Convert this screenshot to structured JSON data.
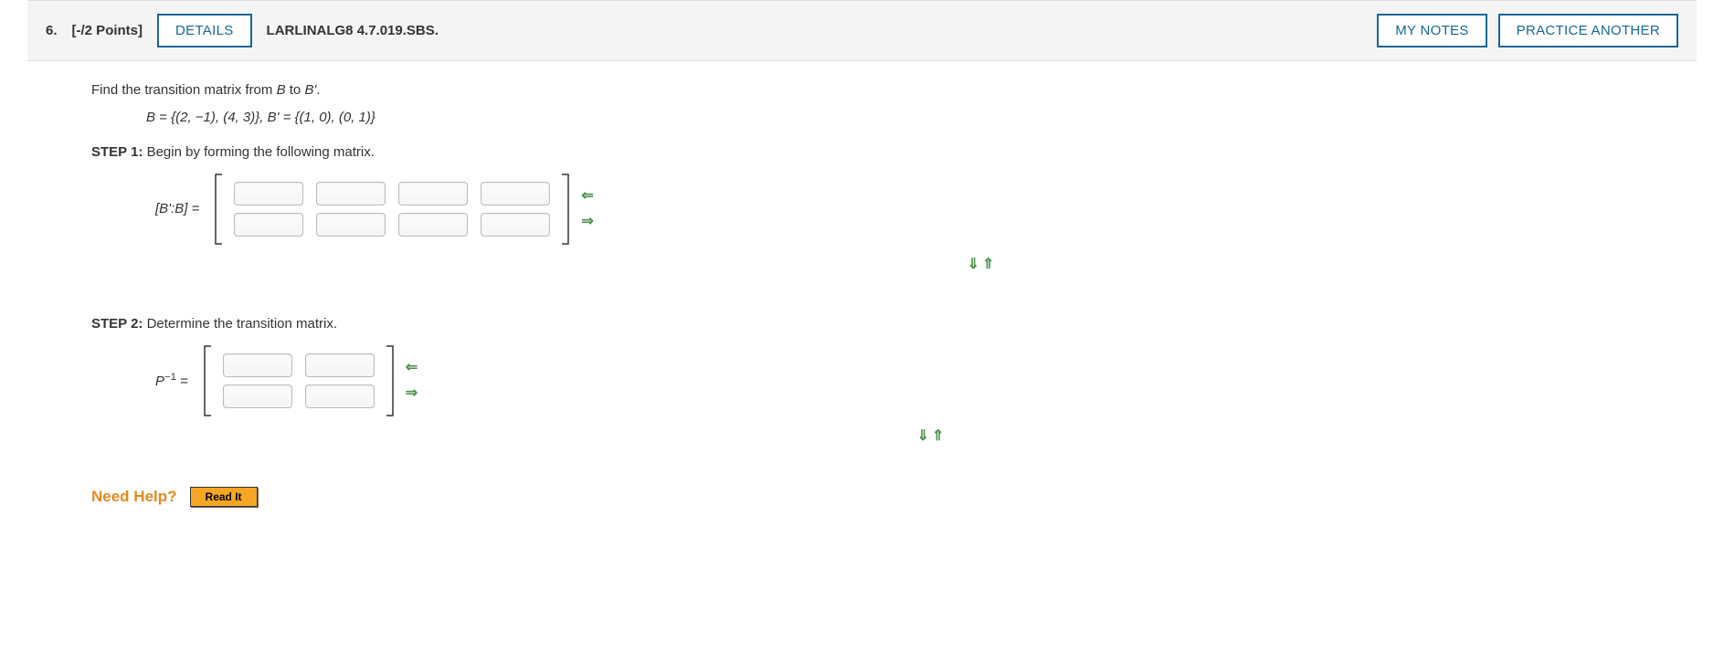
{
  "header": {
    "number": "6.",
    "points": "[-/2 Points]",
    "details": "DETAILS",
    "reference": "LARLINALG8 4.7.019.SBS.",
    "my_notes": "MY NOTES",
    "practice_another": "PRACTICE ANOTHER"
  },
  "body": {
    "prompt_pre": "Find the transition matrix from ",
    "prompt_b": "B",
    "prompt_mid": " to ",
    "prompt_bprime": "B'",
    "prompt_post": ".",
    "equation": "B = {(2, −1), (4, 3)}, B' = {(1, 0), (0, 1)}",
    "step1_label": "STEP 1:",
    "step1_text": " Begin by forming the following matrix.",
    "matrix1_label_pre": "[",
    "matrix1_label_bprime": "B'",
    "matrix1_label_colon": ":",
    "matrix1_label_b": "B",
    "matrix1_label_post": "] =",
    "step2_label": "STEP 2:",
    "step2_text": " Determine the transition matrix.",
    "matrix2_label": "P",
    "matrix2_exp": "−1",
    "matrix2_eq": " =",
    "need_help": "Need Help?",
    "read_it": "Read It"
  },
  "arrows": {
    "left": "⇐",
    "right": "⇒",
    "down": "⇓",
    "up": "⇑"
  }
}
